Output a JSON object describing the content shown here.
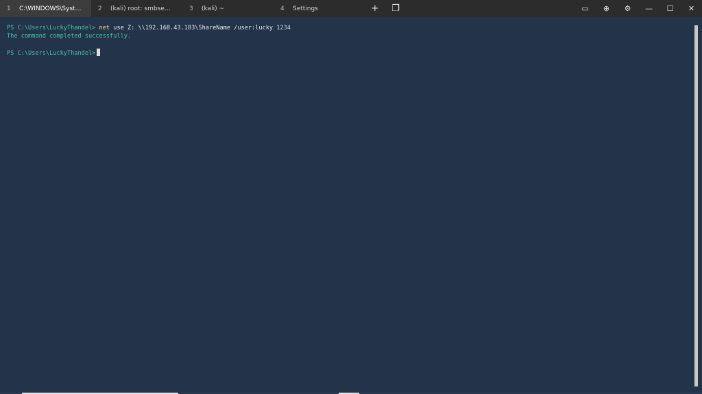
{
  "tabs": [
    {
      "num": "1",
      "title": "C:\\WINDOWS\\Syst…"
    },
    {
      "num": "2",
      "title": "(kali) root: smbse…"
    },
    {
      "num": "3",
      "title": "(kali) ~"
    },
    {
      "num": "4",
      "title": "Settings"
    }
  ],
  "icons": {
    "new_tab": "+",
    "tab_menu": "❐",
    "keyboard": "▭",
    "globe": "⊕",
    "settings": "⚙",
    "minimize": "—",
    "maximize": "☐",
    "close": "✕"
  },
  "terminal": {
    "line1_prompt": "PS C:\\Users\\LuckyThandel>",
    "line1_cmd": "net",
    "line1_args": "use Z: \\\\192.168.43.183\\ShareName /user:lucky",
    "line1_pass": "1234",
    "line2_output": "The command completed successfully.",
    "line4_prompt": "PS C:\\Users\\LuckyThandel>"
  },
  "colors": {
    "background": "#22334a",
    "prompt": "#4fc3a1",
    "command": "#f2e68a"
  }
}
